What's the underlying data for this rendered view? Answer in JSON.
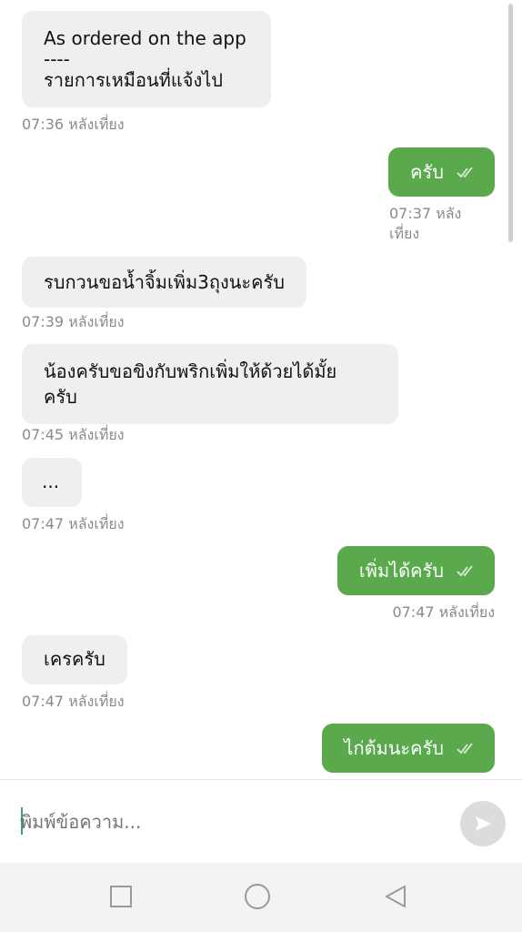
{
  "messages": [
    {
      "side": "in",
      "lines": [
        "As ordered on the app",
        "----",
        "รายการเหมือนที่แจ้งไป"
      ],
      "time": "07:36 หลังเที่ยง"
    },
    {
      "side": "out",
      "lines": [
        "ครับ"
      ],
      "time_lines": [
        "07:37 หลัง",
        "เที่ยง"
      ],
      "read": true
    },
    {
      "side": "in",
      "lines": [
        "รบกวนขอน้ำจิ้มเพิ่ม3ถุงนะครับ"
      ],
      "time": "07:39 หลังเที่ยง"
    },
    {
      "side": "in",
      "lines": [
        "น้องครับขอขิงกับพริกเพิ่มให้ด้วยได้มั้ย",
        "ครับ"
      ],
      "time": "07:45 หลังเที่ยง"
    },
    {
      "side": "in",
      "lines": [
        "..."
      ],
      "time": "07:47 หลังเที่ยง"
    },
    {
      "side": "out",
      "lines": [
        "เพิ่มได้ครับ"
      ],
      "time": "07:47 หลังเที่ยง",
      "read": true
    },
    {
      "side": "in",
      "lines": [
        "เครครับ"
      ],
      "time": "07:47 หลังเที่ยง"
    },
    {
      "side": "out",
      "lines": [
        "ไก่ต้มนะครับ"
      ],
      "read": true
    }
  ],
  "composer": {
    "placeholder": "พิมพ์ข้อความ...",
    "send_icon": "send-icon"
  },
  "nav": {
    "recents_icon": "square-icon",
    "home_icon": "circle-icon",
    "back_icon": "triangle-back-icon"
  },
  "colors": {
    "outgoing_bubble": "#5aaa4d",
    "incoming_bubble": "#efefef",
    "timestamp": "#8a8a8a"
  }
}
